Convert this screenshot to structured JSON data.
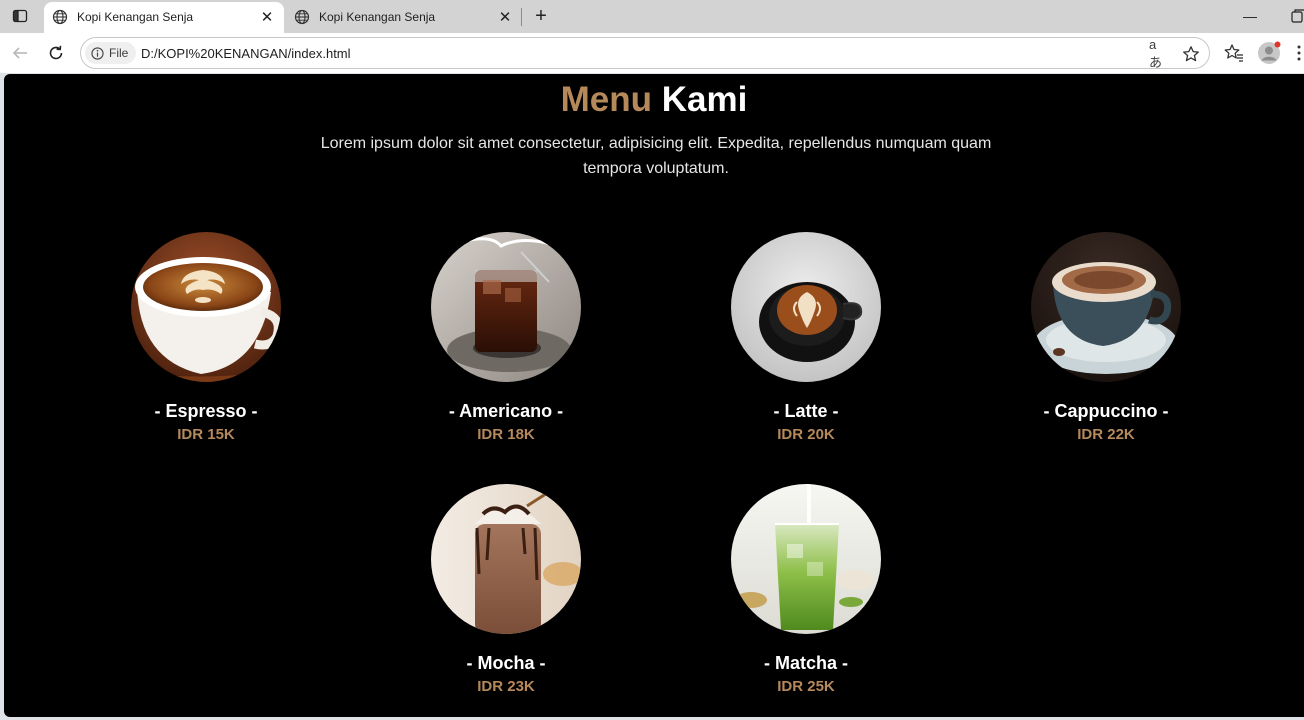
{
  "browser": {
    "tabs": [
      {
        "title": "Kopi Kenangan Senja",
        "active": true,
        "close_label": "✕"
      },
      {
        "title": "Kopi Kenangan Senja",
        "active": false,
        "close_label": "✕"
      }
    ],
    "new_tab_label": "+",
    "minimize_label": "—",
    "site_chip_label": "File",
    "url": "D:/KOPI%20KENANGAN/index.html",
    "read_aloud_label": "aあ",
    "icons": {
      "sidebar": "sidebar-toggle-icon",
      "globe": "globe-icon",
      "back": "back-arrow-icon",
      "reload": "reload-icon",
      "info": "info-icon",
      "star": "star-icon",
      "favorites": "favorites-icon",
      "profile": "profile-avatar-icon",
      "more": "more-icon"
    }
  },
  "page": {
    "heading_accent": "Menu",
    "heading_plain": "Kami",
    "intro": "Lorem ipsum dolor sit amet consectetur, adipisicing elit. Expedita, repellendus numquam quam tempora voluptatum.",
    "accent_color": "#b6895b",
    "menu": [
      {
        "name": "- Espresso -",
        "price": "IDR 15K"
      },
      {
        "name": "- Americano -",
        "price": "IDR 18K"
      },
      {
        "name": "- Latte -",
        "price": "IDR 20K"
      },
      {
        "name": "- Cappuccino -",
        "price": "IDR 22K"
      },
      {
        "name": "- Mocha -",
        "price": "IDR 23K"
      },
      {
        "name": "- Matcha -",
        "price": "IDR 25K"
      }
    ]
  }
}
